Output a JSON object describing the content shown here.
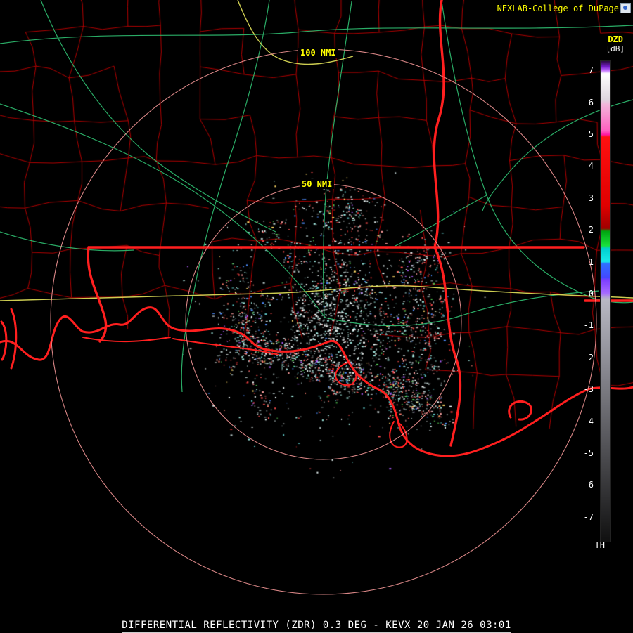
{
  "brand": {
    "text": "NEXLAB-College of DuPage"
  },
  "colorbar": {
    "product": "DZD",
    "units": "[dB]",
    "bottom_label": "TH",
    "ticks": [
      7,
      6,
      5,
      4,
      3,
      2,
      1,
      0,
      -1,
      -2,
      -3,
      -4,
      -5,
      -6,
      -7
    ],
    "gradient": [
      {
        "p": 0,
        "c": "#2a0a3e"
      },
      {
        "p": 1.2,
        "c": "#7a1fd0"
      },
      {
        "p": 2.0,
        "c": "#c97bff"
      },
      {
        "p": 2.6,
        "c": "#ffffff"
      },
      {
        "p": 8.0,
        "c": "#ded6de"
      },
      {
        "p": 9.0,
        "c": "#f2b6da"
      },
      {
        "p": 14.5,
        "c": "#ff5fc0"
      },
      {
        "p": 15.3,
        "c": "#ff19a3"
      },
      {
        "p": 15.8,
        "c": "#ff1010"
      },
      {
        "p": 30.0,
        "c": "#e00000"
      },
      {
        "p": 34.8,
        "c": "#a00000"
      },
      {
        "p": 35.4,
        "c": "#00a510"
      },
      {
        "p": 38.4,
        "c": "#19e03c"
      },
      {
        "p": 39.0,
        "c": "#00cfcf"
      },
      {
        "p": 41.7,
        "c": "#19e8e8"
      },
      {
        "p": 42.2,
        "c": "#2f6fff"
      },
      {
        "p": 45.0,
        "c": "#4348ff"
      },
      {
        "p": 45.6,
        "c": "#7e3fff"
      },
      {
        "p": 48.3,
        "c": "#a66bff"
      },
      {
        "p": 49.5,
        "c": "#b9b9c4"
      },
      {
        "p": 100,
        "c": "#101010"
      }
    ]
  },
  "range_rings": [
    {
      "label": "100 NMI"
    },
    {
      "label": "50 NMI"
    }
  ],
  "footer": {
    "caption": "DIFFERENTIAL REFLECTIVITY (ZDR) 0.3 DEG - KEVX 20 JAN 26 03:01"
  },
  "colors": {
    "background": "#000000",
    "county_line": "#bb0000",
    "state_line": "#ff1f1f",
    "coastline": "#ff1f1f",
    "highway_green": "#2fbf71",
    "highway_yellow": "#d8d855",
    "ring": "#ff9e9e",
    "label_yellow": "#ffff00",
    "label_white": "#ffffff"
  },
  "radar": {
    "echo_colors": [
      {
        "c": "#e8f4f4",
        "w": 14
      },
      {
        "c": "#aebfbf",
        "w": 16
      },
      {
        "c": "#7e9090",
        "w": 8
      },
      {
        "c": "#9fe8df",
        "w": 12
      },
      {
        "c": "#5fc8c8",
        "w": 6
      },
      {
        "c": "#ff4f4f",
        "w": 12
      },
      {
        "c": "#c22828",
        "w": 5
      },
      {
        "c": "#ff9f9f",
        "w": 6
      },
      {
        "c": "#ff7f6f",
        "w": 3
      },
      {
        "c": "#4f8fff",
        "w": 5
      },
      {
        "c": "#55cc55",
        "w": 4
      },
      {
        "c": "#b05fff",
        "w": 3
      },
      {
        "c": "#ffd966",
        "w": 2
      }
    ]
  }
}
